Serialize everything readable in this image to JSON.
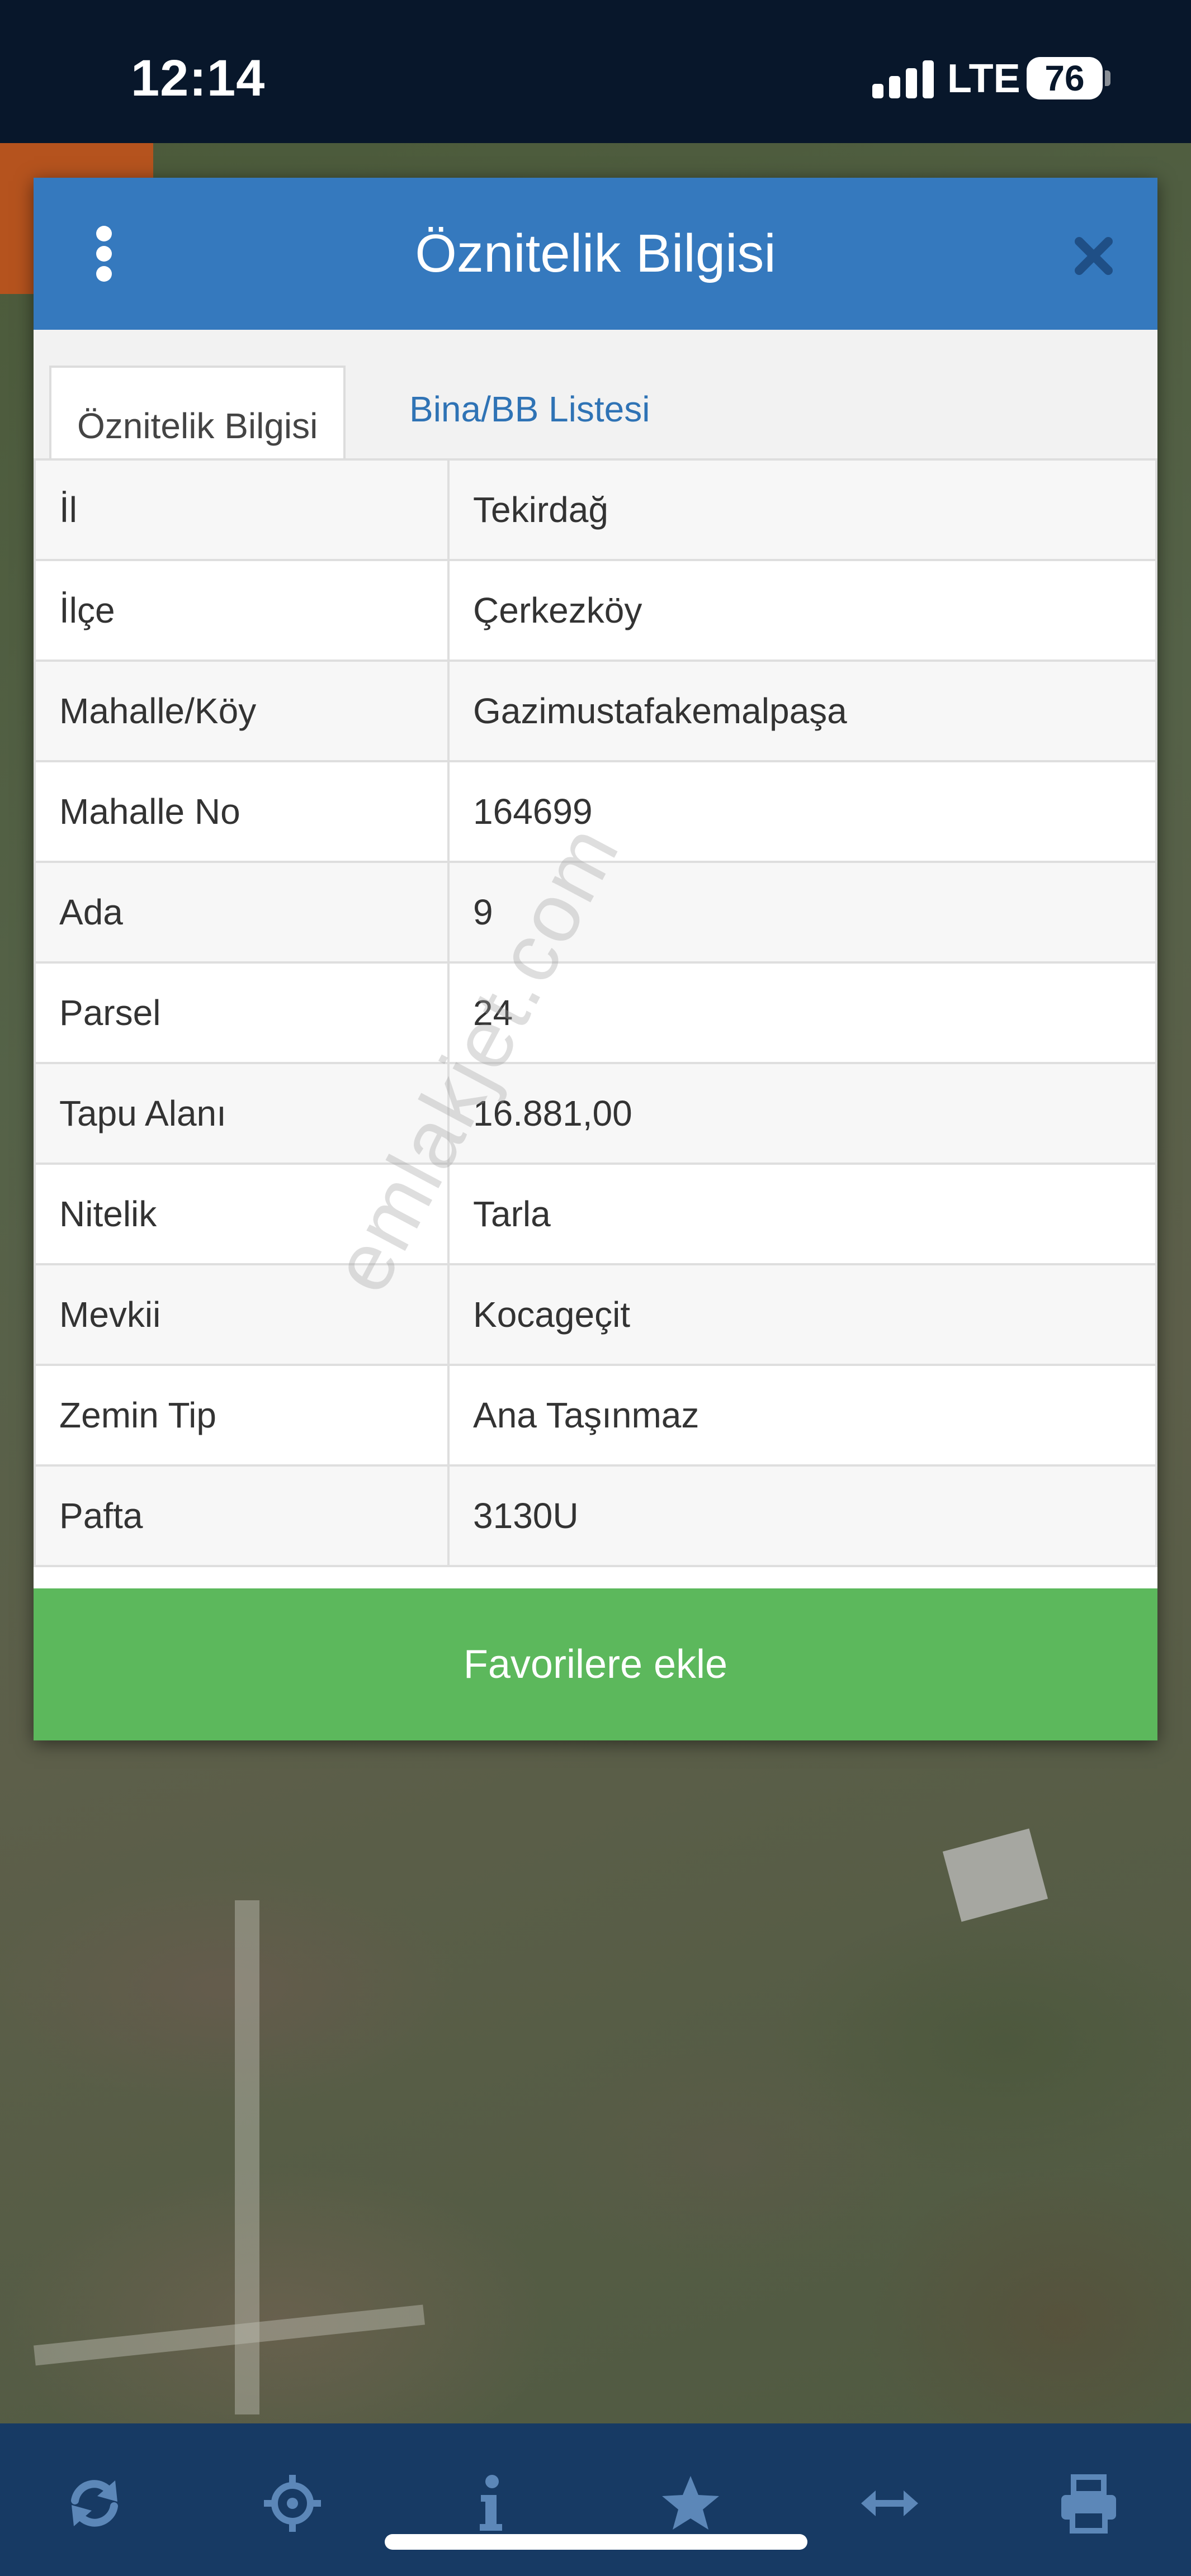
{
  "status_bar": {
    "time": "12:14",
    "network": "LTE",
    "battery": "76"
  },
  "dialog": {
    "title": "Öznitelik Bilgisi",
    "tabs": [
      {
        "label": "Öznitelik Bilgisi",
        "active": true
      },
      {
        "label": "Bina/BB Listesi",
        "active": false
      }
    ],
    "rows": [
      {
        "key": "İl",
        "value": "Tekirdağ"
      },
      {
        "key": "İlçe",
        "value": "Çerkezköy"
      },
      {
        "key": "Mahalle/Köy",
        "value": "Gazimustafakemalpaşa"
      },
      {
        "key": "Mahalle No",
        "value": "164699"
      },
      {
        "key": "Ada",
        "value": "9"
      },
      {
        "key": "Parsel",
        "value": "24"
      },
      {
        "key": "Tapu Alanı",
        "value": "16.881,00"
      },
      {
        "key": "Nitelik",
        "value": "Tarla"
      },
      {
        "key": "Mevkii",
        "value": "Kocageçit"
      },
      {
        "key": "Zemin Tip",
        "value": "Ana Taşınmaz"
      },
      {
        "key": "Pafta",
        "value": "3130U"
      }
    ],
    "favorite_button": "Favorilere ekle"
  },
  "watermark": "emlakjet.com",
  "toolbar": {
    "icons": [
      "refresh-icon",
      "locate-icon",
      "info-icon",
      "star-icon",
      "measure-icon",
      "print-icon"
    ]
  },
  "colors": {
    "header_blue": "#3579be",
    "tab_link_blue": "#2f73b5",
    "favorite_green": "#5cb85c",
    "toolbar_navy": "#173a64",
    "status_bar": "#08172b"
  }
}
